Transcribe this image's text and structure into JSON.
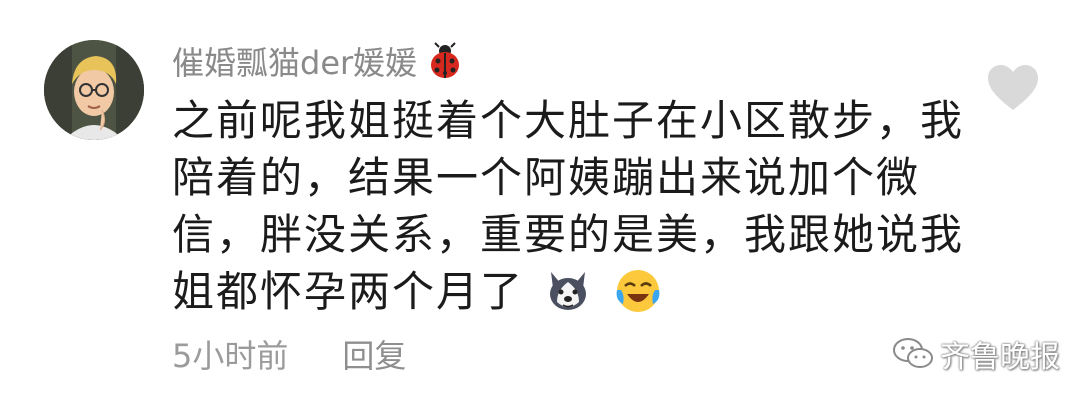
{
  "comment": {
    "username": "催婚瓢猫der媛媛",
    "username_icon": "ladybug-icon",
    "lines": [
      "之前呢我姐挺着个大肚子在小区散步，我",
      "陪着的，结果一个阿姨蹦出来说加个微",
      "信，胖没关系，重要的是美，我跟她说我",
      "姐都怀孕两个月了"
    ],
    "trailing_emojis": [
      "husky-dog-emoji",
      "laughing-tears-emoji"
    ],
    "timestamp": "5小时前",
    "reply_label": "回复",
    "like_icon": "heart-icon"
  },
  "watermark": {
    "text": "齐鲁晚报",
    "icon": "wechat-icon"
  },
  "colors": {
    "username": "#8a8a8a",
    "text": "#1b1b1b",
    "meta": "#9b9b9b",
    "heart": "#d9d9d9"
  }
}
